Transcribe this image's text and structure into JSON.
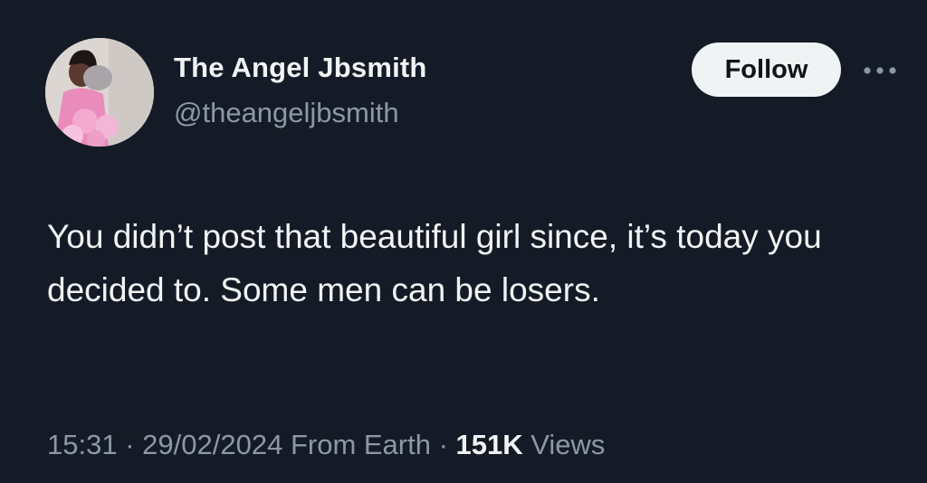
{
  "author": {
    "display_name": "The Angel Jbsmith",
    "handle": "@theangeljbsmith"
  },
  "actions": {
    "follow_label": "Follow",
    "more_icon": "more-horizontal-icon"
  },
  "tweet": {
    "text": "You didn’t post that beautiful girl since, it’s today you decided to. Some men can be losers."
  },
  "meta": {
    "time": "15:31",
    "separator": "·",
    "date": "29/02/2024",
    "source": "From Earth",
    "views_count": "151K",
    "views_label": "Views"
  },
  "colors": {
    "background": "#151b26",
    "primary_text": "#f1f3f4",
    "secondary_text": "#8b98a5",
    "follow_button_bg": "#eff3f4",
    "follow_button_text": "#0f1419"
  }
}
